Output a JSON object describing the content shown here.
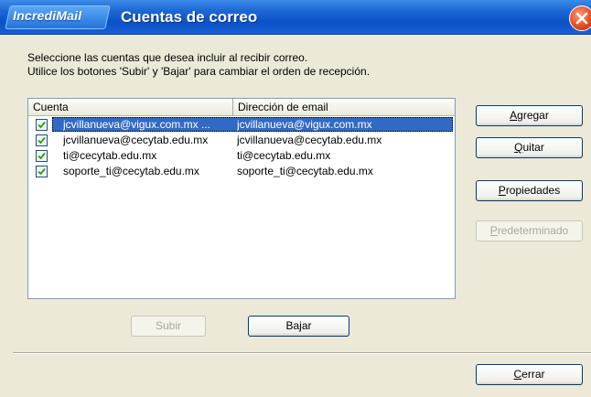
{
  "window": {
    "brand": "IncrediMail",
    "title": "Cuentas de correo"
  },
  "instructions": {
    "line1": "Seleccione las cuentas que desea incluir al recibir correo.",
    "line2": "Utilice los botones 'Subir' y 'Bajar' para cambiar el orden de recepción."
  },
  "accounts_list": {
    "columns": [
      "Cuenta",
      "Dirección de email"
    ],
    "rows": [
      {
        "account": "jcvillanueva@vigux.com.mx ...",
        "email": "jcvillanueva@vigux.com.mx",
        "checked": true,
        "selected": true
      },
      {
        "account": "jcvillanueva@cecytab.edu.mx",
        "email": "jcvillanueva@cecytab.edu.mx",
        "checked": true,
        "selected": false
      },
      {
        "account": "ti@cecytab.edu.mx",
        "email": "ti@cecytab.edu.mx",
        "checked": true,
        "selected": false
      },
      {
        "account": "soporte_ti@cecytab.edu.mx",
        "email": "soporte_ti@cecytab.edu.mx",
        "checked": true,
        "selected": false
      }
    ]
  },
  "buttons": {
    "add": {
      "prefix": "",
      "accel": "A",
      "rest": "gregar"
    },
    "remove": {
      "prefix": "",
      "accel": "Q",
      "rest": "uitar"
    },
    "properties": {
      "prefix": "",
      "accel": "P",
      "rest": "ropiedades"
    },
    "default": {
      "prefix": "",
      "accel": "P",
      "rest": "redeterminado"
    },
    "up": "Subir",
    "down": "Bajar",
    "close": {
      "prefix": "",
      "accel": "C",
      "rest": "errar"
    }
  },
  "colors": {
    "titlebar": "#0a53c8",
    "selection": "#316ac5",
    "dialog_bg": "#ece9d8",
    "close_button": "#e2461c"
  },
  "icons": [
    "close-icon",
    "checkmark-icon"
  ]
}
